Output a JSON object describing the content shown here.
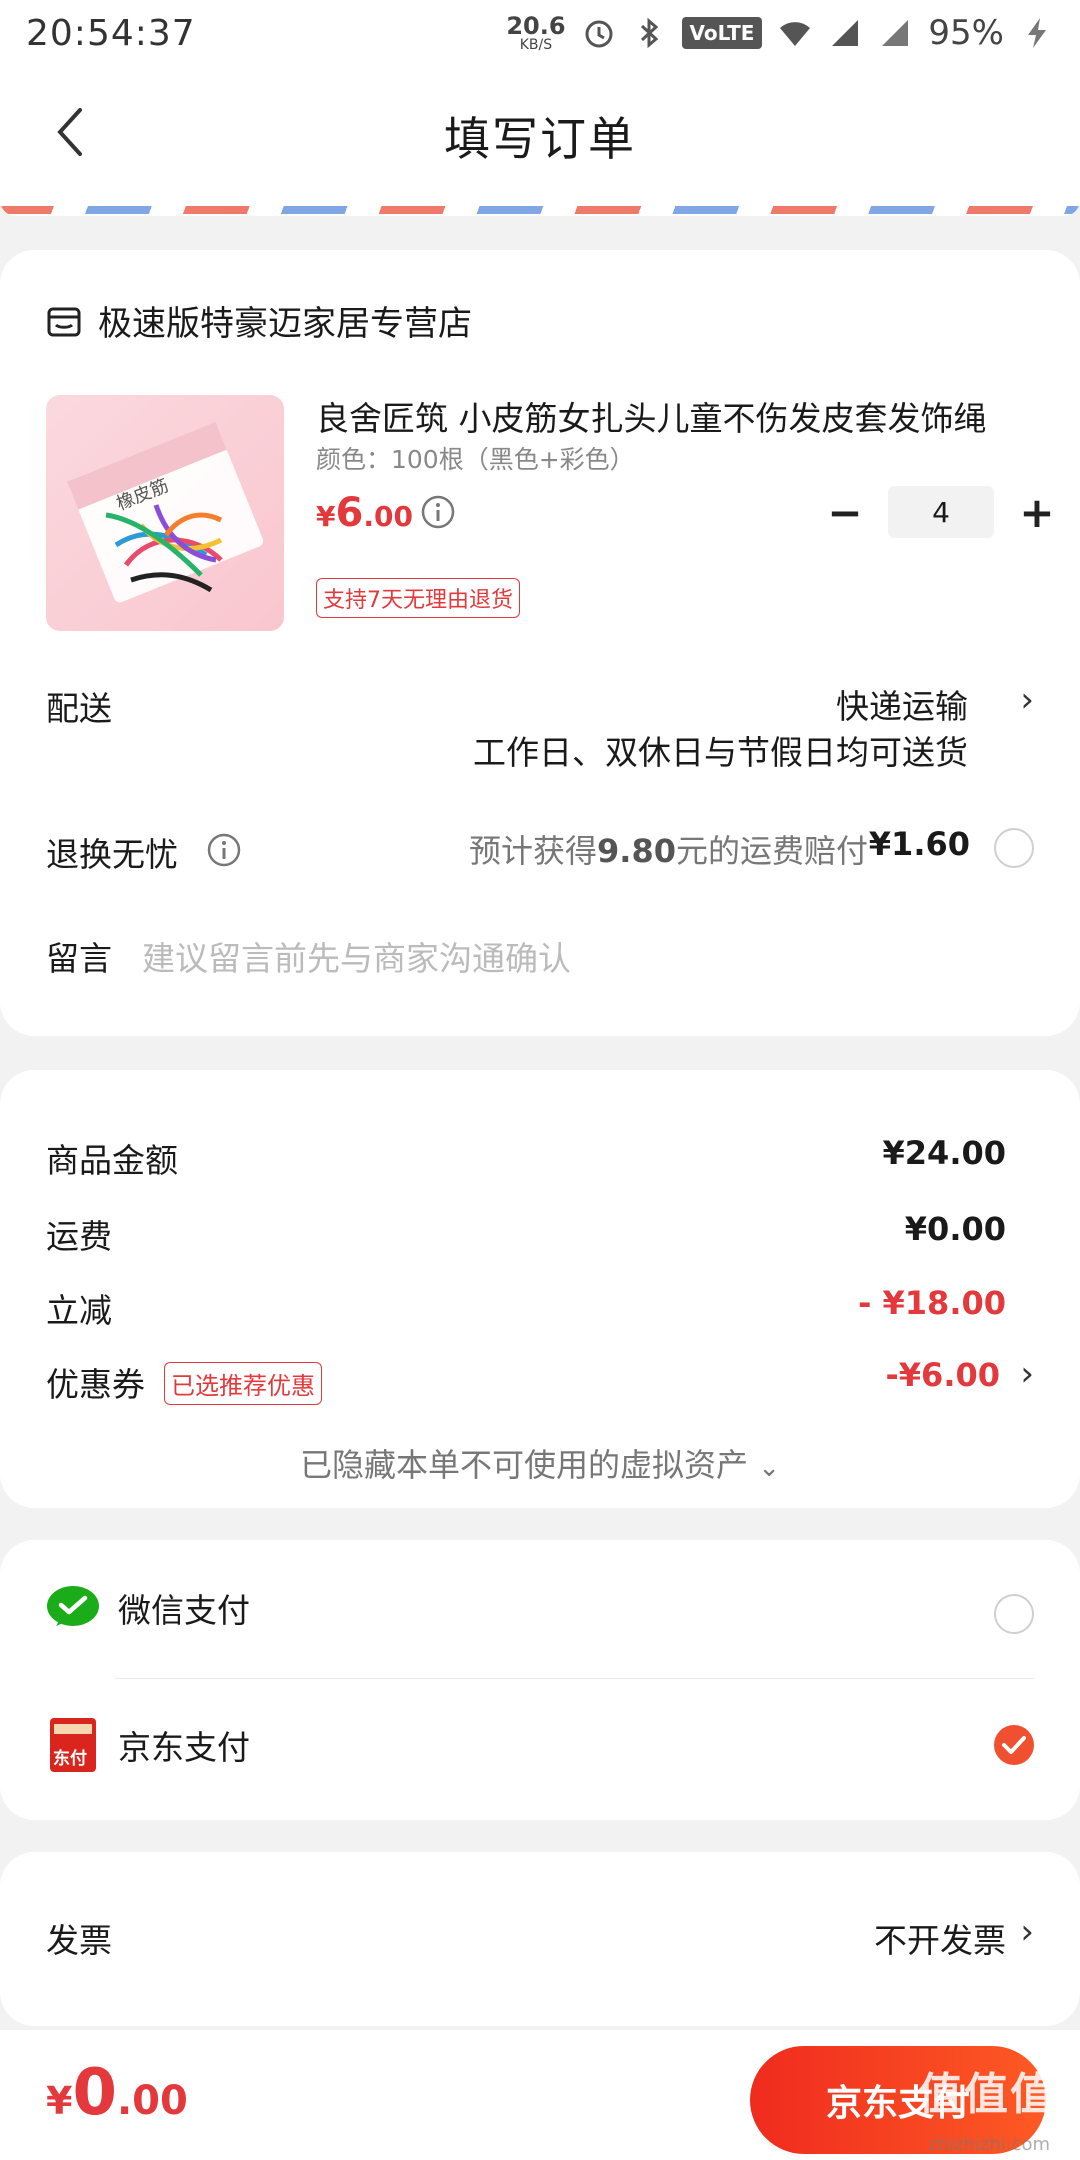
{
  "status_bar": {
    "time": "20:54:37",
    "net_speed": "20.6",
    "net_unit": "KB/S",
    "volte": "VoLTE",
    "battery": "95%"
  },
  "header": {
    "title": "填写订单"
  },
  "store": {
    "name": "极速版特豪迈家居专营店"
  },
  "product": {
    "title": "良舍匠筑 小皮筋女扎头儿童不伤发皮套发饰绳",
    "spec": "颜色：100根（黑色+彩色）",
    "price_symbol": "¥",
    "price_int": "6",
    "price_dec": ".00",
    "quantity": "4",
    "qty_minus": "−",
    "qty_plus": "+",
    "return_badge": "支持7天无理由退货",
    "image_text": "橡皮筋"
  },
  "delivery": {
    "label": "配送",
    "value": "快递运输",
    "note": "工作日、双休日与节假日均可送货"
  },
  "worry_free": {
    "label": "退换无忧",
    "desc_prefix": "预计获得",
    "desc_amount": "9.80",
    "desc_suffix": "元的运费赔付",
    "price": "¥1.60"
  },
  "message": {
    "label": "留言",
    "placeholder": "建议留言前先与商家沟通确认"
  },
  "summary": {
    "goods_label": "商品金额",
    "goods_value": "¥24.00",
    "shipping_label": "运费",
    "shipping_value": "¥0.00",
    "discount_label": "立减",
    "discount_value": "- ¥18.00",
    "coupon_label": "优惠券",
    "coupon_badge": "已选推荐优惠",
    "coupon_value": "-¥6.00",
    "hidden_note": "已隐藏本单不可使用的虚拟资产"
  },
  "payment": {
    "wechat_label": "微信支付",
    "jd_label": "京东支付",
    "jd_icon_text": "东付",
    "selected": "jd"
  },
  "invoice": {
    "label": "发票",
    "value": "不开发票"
  },
  "bottom": {
    "total_symbol": "¥",
    "total_int": "0",
    "total_dec": ".00",
    "submit_label": "京东支付",
    "watermark": "值值值",
    "watermark_sub": "zhizhizhi.com"
  },
  "colors": {
    "accent": "#e4393c",
    "button": "#f0502f",
    "wechat": "#1aad19"
  }
}
